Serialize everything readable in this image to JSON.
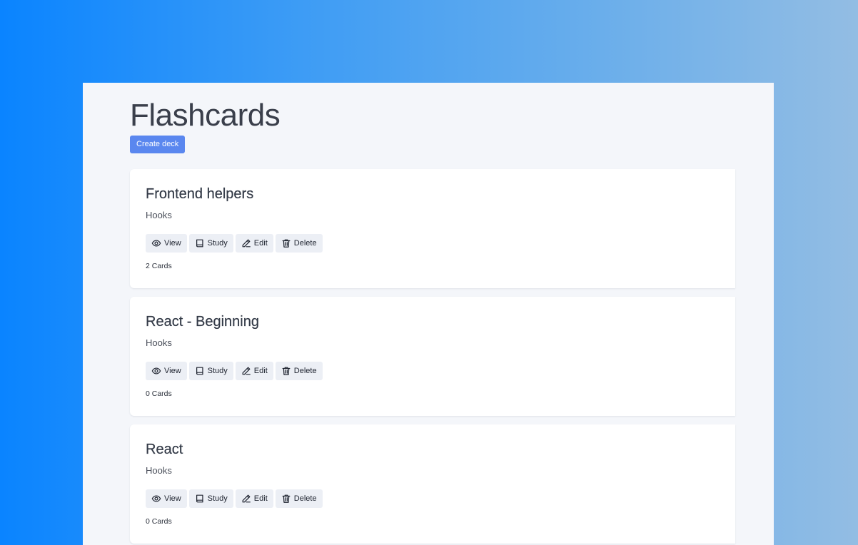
{
  "app": {
    "title": "Flashcards",
    "create_deck_label": "Create deck"
  },
  "actions": {
    "view_label": "View",
    "study_label": "Study",
    "edit_label": "Edit",
    "delete_label": "Delete",
    "icons": [
      "eye-icon",
      "book-icon",
      "pencil-icon",
      "trash-icon"
    ]
  },
  "colors": {
    "primary_button": "#5a87ef",
    "window_background": "#f4f6fa",
    "card_background": "#ffffff",
    "action_button_background": "#eceff5",
    "title_text": "#3a3f4b"
  },
  "decks": [
    {
      "title": "Frontend helpers",
      "description": "Hooks",
      "card_count": "2 Cards"
    },
    {
      "title": "React - Beginning",
      "description": "Hooks",
      "card_count": "0 Cards"
    },
    {
      "title": "React",
      "description": "Hooks",
      "card_count": "0 Cards"
    }
  ]
}
